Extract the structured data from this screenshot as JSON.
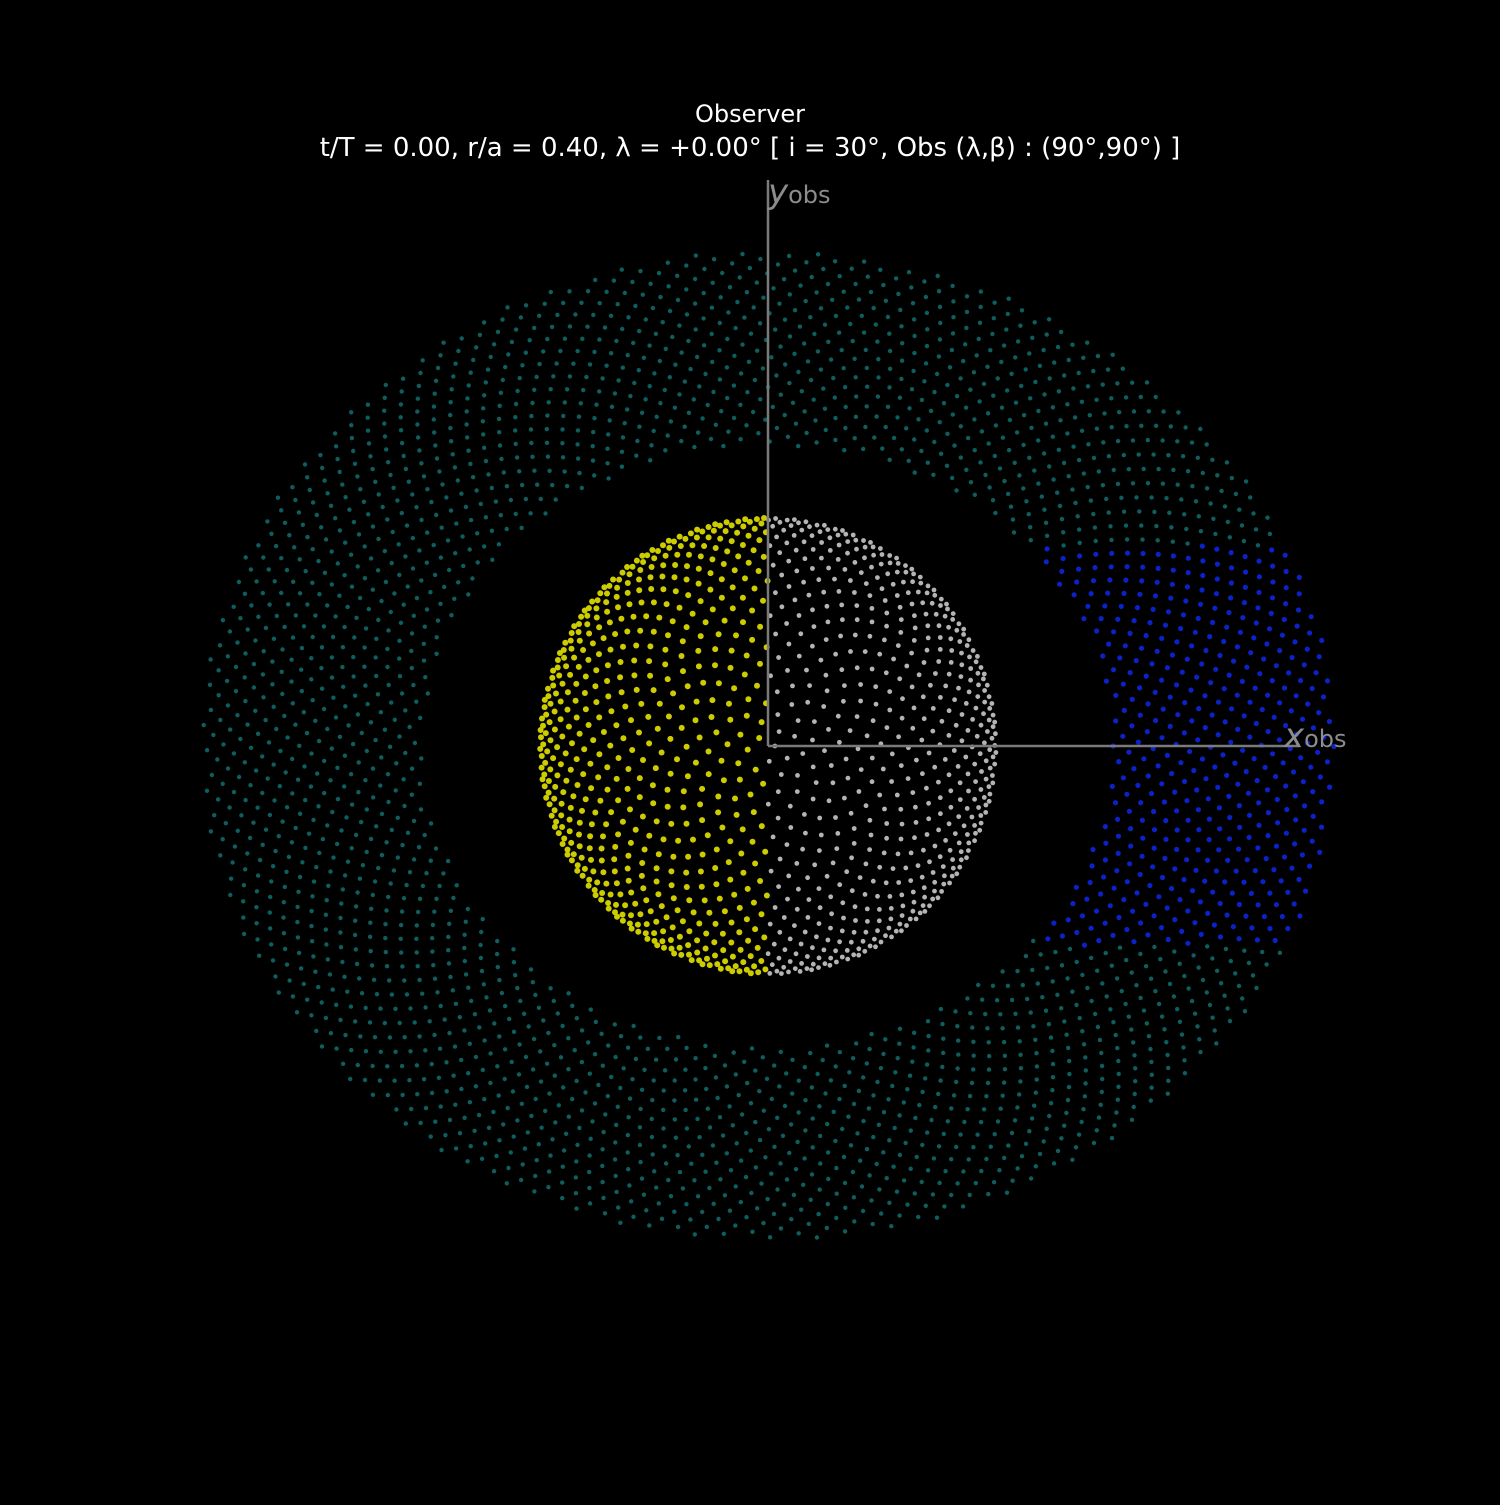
{
  "title": {
    "line1": "Observer",
    "line2": "t/T = 0.00, r/a = 0.40, λ = +0.00° [ i = 30°, Obs (λ,β) : (90°,90°) ]"
  },
  "axes": {
    "x_symbol": "x",
    "x_subscript": "obs",
    "y_symbol": "y",
    "y_subscript": "obs"
  },
  "colors": {
    "background": "#000000",
    "axis": "#7a7a7a",
    "ring_lit": "#0e5e5e",
    "ring_shadow": "#0a22c8",
    "planet_day": "#cccc00",
    "planet_night": "#b4b4b4"
  },
  "scene": {
    "time_fraction": 0.0,
    "radius_over_a": 0.4,
    "lambda_deg": 0.0,
    "inclination_deg": 30,
    "observer_lambda_deg": 90,
    "observer_beta_deg": 90
  }
}
